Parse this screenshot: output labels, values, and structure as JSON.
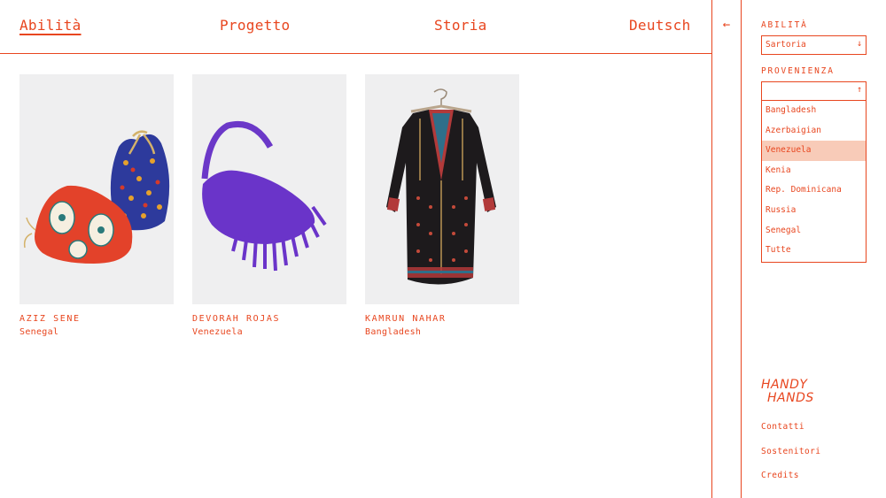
{
  "nav": {
    "abilita": "Abilità",
    "progetto": "Progetto",
    "storia": "Storia",
    "deutsch": "Deutsch"
  },
  "back_icon": "←",
  "products": [
    {
      "name": "AZIZ SENE",
      "country": "Senegal",
      "image": "two patterned drawstring pouches"
    },
    {
      "name": "DEVORAH ROJAS",
      "country": "Venezuela",
      "image": "purple suede fringe bag"
    },
    {
      "name": "KAMRUN NAHAR",
      "country": "Bangladesh",
      "image": "black embroidered tunic dress on hanger"
    }
  ],
  "sidebar": {
    "abilita_label": "ABILITÀ",
    "abilita_value": "Sartoria",
    "abilita_arrow": "↓",
    "provenienza_label": "PROVENIENZA",
    "provenienza_value": "",
    "provenienza_arrow": "↑",
    "options": [
      "Bangladesh",
      "Azerbaigian",
      "Venezuela",
      "Kenia",
      "Rep. Dominicana",
      "Russia",
      "Senegal",
      "Tutte"
    ],
    "highlighted_option": "Venezuela",
    "logo_line1": "HANDY",
    "logo_line2": "HANDS",
    "footer_links": [
      "Contatti",
      "Sostenitori",
      "Credits"
    ]
  },
  "colors": {
    "accent": "#e8461f",
    "highlight": "#f8cbb8",
    "card_bg": "#efeff0"
  }
}
